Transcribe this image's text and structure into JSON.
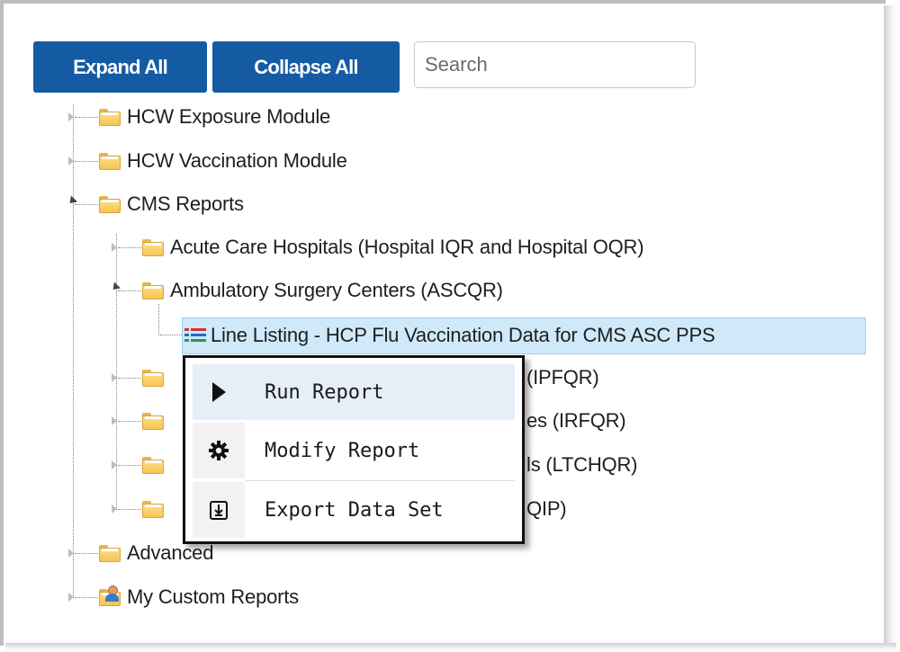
{
  "toolbar": {
    "expand_all_label": "Expand All",
    "collapse_all_label": "Collapse All",
    "search_placeholder": "Search"
  },
  "tree": {
    "root_items": [
      {
        "label": "HCW Exposure Module",
        "state": "collapsed"
      },
      {
        "label": "HCW Vaccination Module",
        "state": "collapsed"
      },
      {
        "label": "CMS Reports",
        "state": "expanded"
      }
    ],
    "cms_children": [
      {
        "label": "Acute Care Hospitals (Hospital IQR and Hospital OQR)",
        "state": "collapsed"
      },
      {
        "label": "Ambulatory Surgery Centers (ASCQR)",
        "state": "expanded"
      }
    ],
    "selected_report": {
      "label": "Line Listing - HCP Flu Vaccination Data for CMS ASC PPS",
      "icon": "list-report-icon"
    },
    "partially_hidden": [
      {
        "visible_suffix": "(IPFQR)"
      },
      {
        "visible_suffix": "es (IRFQR)"
      },
      {
        "visible_suffix": "ls (LTCHQR)"
      },
      {
        "visible_suffix": "QIP)"
      }
    ],
    "bottom_items": [
      {
        "label": "Advanced",
        "state": "collapsed",
        "icon": "folder-icon"
      },
      {
        "label": "My Custom Reports",
        "state": "collapsed",
        "icon": "user-folder-icon"
      }
    ]
  },
  "context_menu": {
    "items": [
      {
        "label": "Run Report",
        "icon": "play-icon"
      },
      {
        "label": "Modify Report",
        "icon": "gear-icon"
      },
      {
        "label": "Export Data Set",
        "icon": "export-icon"
      }
    ]
  },
  "colors": {
    "button_bg": "#155ba3",
    "selection_bg": "#cfe9fb",
    "menu_border": "#111111"
  }
}
